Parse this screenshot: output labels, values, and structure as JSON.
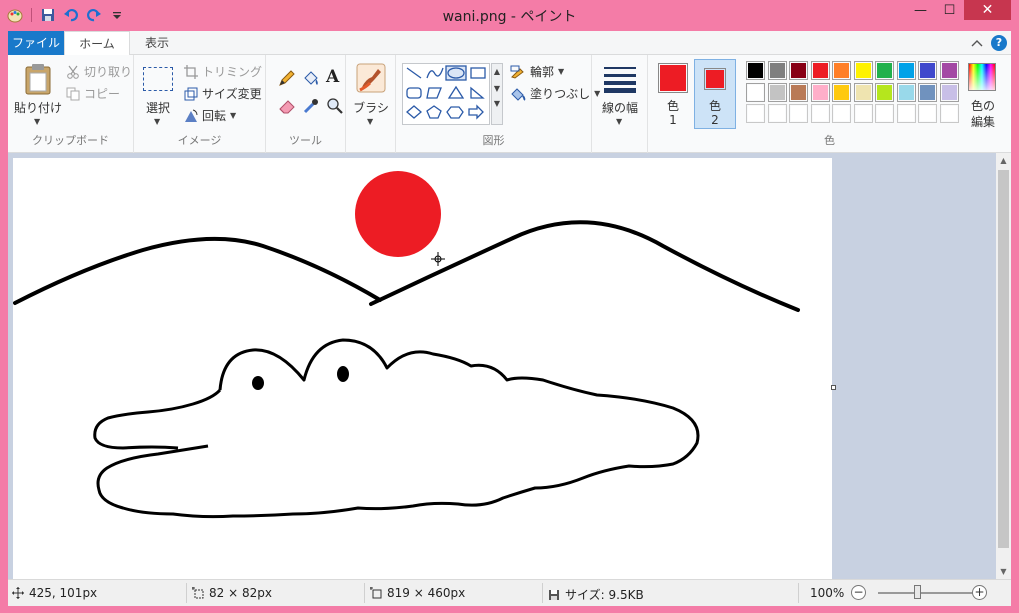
{
  "window": {
    "title": "wani.png - ペイント",
    "controls": {
      "minimize": "—",
      "maximize": "☐",
      "close": "✕"
    }
  },
  "quick_access": [
    "paint-app-icon",
    "save-icon",
    "undo-icon",
    "redo-icon",
    "customize-icon"
  ],
  "tabs": {
    "file": "ファイル",
    "home": "ホーム",
    "view": "表示"
  },
  "ribbon": {
    "clipboard": {
      "paste": "貼り付け",
      "cut": "切り取り",
      "copy": "コピー",
      "label": "クリップボード"
    },
    "image": {
      "select": "選択",
      "crop": "トリミング",
      "resize": "サイズ変更",
      "rotate": "回転",
      "label": "イメージ"
    },
    "tools": {
      "label": "ツール",
      "items": [
        "pencil-icon",
        "fill-icon",
        "text-icon",
        "eraser-icon",
        "color-picker-icon",
        "magnifier-icon"
      ]
    },
    "brushes": {
      "label": "ブラシ"
    },
    "shapes": {
      "label": "図形",
      "outline": "輪郭",
      "fill": "塗りつぶし"
    },
    "size": {
      "label": "線の幅"
    },
    "colors": {
      "label": "色",
      "color1_label": "色\n1",
      "color1_a": "色",
      "color1_b": "1",
      "color2_a": "色",
      "color2_b": "2",
      "edit_a": "色の",
      "edit_b": "編集",
      "color1": "#ed1c24",
      "color2": "#ed1c24",
      "palette_row1": [
        "#000000",
        "#7f7f7f",
        "#880015",
        "#ed1c24",
        "#ff7f27",
        "#fff200",
        "#22b14c",
        "#00a2e8",
        "#3f48cc",
        "#a349a4"
      ],
      "palette_row2": [
        "#ffffff",
        "#c3c3c3",
        "#b97a57",
        "#ffaec9",
        "#ffc90e",
        "#efe4b0",
        "#b5e61d",
        "#99d9ea",
        "#7092be",
        "#c8bfe7"
      ],
      "palette_row3": [
        "#ffffff",
        "#ffffff",
        "#ffffff",
        "#ffffff",
        "#ffffff",
        "#ffffff",
        "#ffffff",
        "#ffffff",
        "#ffffff",
        "#ffffff"
      ]
    }
  },
  "status": {
    "cursor_pos": "425, 101px",
    "selection_size": "82 × 82px",
    "image_size": "819 × 460px",
    "file_size": "サイズ: 9.5KB",
    "zoom": "100%"
  }
}
